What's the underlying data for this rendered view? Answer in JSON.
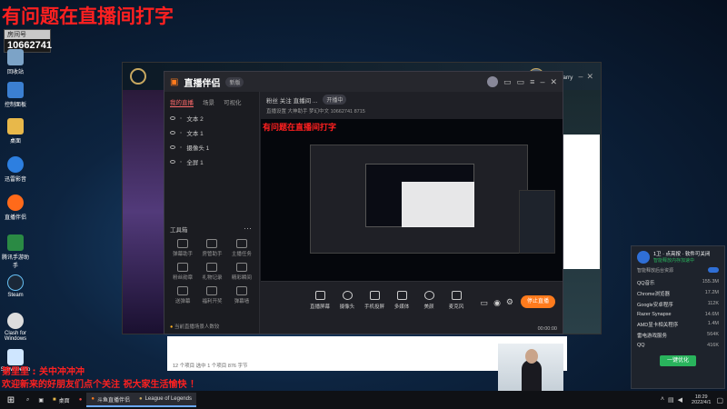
{
  "overlay": {
    "top_text": "有问题在直播间打字",
    "room_label": "房间号",
    "room_number": "10662741",
    "chat_user": "第里里 : 关中冲冲冲",
    "chat_welcome": "欢迎新来的好朋友们点个关注 祝大家生活愉快 ！"
  },
  "desktop_icons": [
    {
      "label": "回收站"
    },
    {
      "label": "控制面板"
    },
    {
      "label": "桌面"
    },
    {
      "label": "迅雷影音"
    },
    {
      "label": "直播伴侣"
    },
    {
      "label": "腾讯手游助手"
    },
    {
      "label": "Steam"
    },
    {
      "label": "Clash for Windows"
    },
    {
      "label": "Snow Demo"
    }
  ],
  "game_client": {
    "currency": "4040",
    "username": "羽毛carry"
  },
  "streamer_app": {
    "logo": "直播伴侣",
    "version_badge": "新版",
    "tabs": [
      "我的直播",
      "场景",
      "可视化"
    ],
    "layers": [
      "文本 2",
      "文本 1",
      "摄像头 1",
      "全屏 1"
    ],
    "room_title": "粉丝 关注 直播间 ...",
    "status_badge": "开播中",
    "room_info": "直播设置  大神助手  梦幻中文  10662741  8715",
    "tools_title": "工具箱",
    "tools": [
      "弹幕助手",
      "房管助手",
      "主播任务",
      "粉丝勋章",
      "礼物记录",
      "精彩瞬间",
      "送弹幕",
      "福利开奖",
      "弹幕墙"
    ],
    "bottom_actions": [
      "直播屏幕",
      "摄像头",
      "手机投屏",
      "多媒体",
      "美颜",
      "麦克风"
    ],
    "go_live": "停止直播",
    "footer_status": "当前直播场景人数较",
    "time_display": "00:00:00"
  },
  "explorer": {
    "status_bar": "12 个项目   选中 1 个项目  876 字节"
  },
  "taskbar": {
    "search_icon": "search-icon",
    "items": [
      "桌面",
      "斗鱼直播伴侣",
      "League of Legends"
    ],
    "clock_time": "18:29",
    "clock_date": "2022/4/1"
  },
  "tray_popup": {
    "title": "1卫 · 点亮按 · 软件可关闭",
    "subtitle": "智能释放内存加速中",
    "toggle_label": "智能释放后台资源",
    "rows": [
      {
        "name": "QQ音乐",
        "value": "155.3M"
      },
      {
        "name": "Chrome浏览器",
        "value": "17.2M"
      },
      {
        "name": "Google安卓程序",
        "value": "112K"
      },
      {
        "name": "Razer Synapse",
        "value": "14.6M"
      },
      {
        "name": "AMD显卡相关程序",
        "value": "1.4M"
      },
      {
        "name": "雷电游戏服务",
        "value": "564K"
      },
      {
        "name": "QQ",
        "value": "416K"
      }
    ],
    "button": "一键优化"
  },
  "colors": {
    "overlay_red": "#ff2020",
    "go_live_orange": "#ff7b1d",
    "optimize_green": "#29b35c"
  }
}
